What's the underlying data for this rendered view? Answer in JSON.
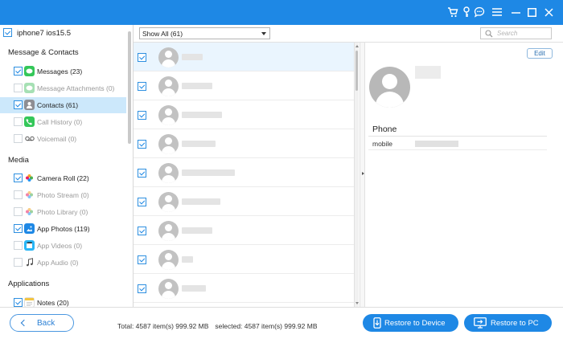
{
  "device": {
    "label": "iphone7 ios15.5",
    "checked": true
  },
  "sidebar": {
    "sections": [
      {
        "title": "Message & Contacts"
      },
      {
        "title": "Media"
      },
      {
        "title": "Applications"
      }
    ],
    "items": [
      {
        "label": "Messages (23)",
        "checked": true,
        "enabled": true,
        "icon": "messages-icon",
        "color": "#34c759"
      },
      {
        "label": "Message Attachments (0)",
        "checked": false,
        "enabled": false,
        "icon": "attachments-icon",
        "color": "#34c759"
      },
      {
        "label": "Contacts (61)",
        "checked": true,
        "enabled": true,
        "selected": true,
        "icon": "contacts-icon",
        "color": "#8e8e93"
      },
      {
        "label": "Call History (0)",
        "checked": false,
        "enabled": false,
        "icon": "phone-icon",
        "color": "#34c759"
      },
      {
        "label": "Voicemail (0)",
        "checked": false,
        "enabled": false,
        "icon": "voicemail-icon",
        "color": "#555555"
      },
      {
        "label": "Camera Roll (22)",
        "checked": true,
        "enabled": true,
        "icon": "camera-roll-icon",
        "color": "#f5a623"
      },
      {
        "label": "Photo Stream (0)",
        "checked": false,
        "enabled": false,
        "icon": "photo-stream-icon",
        "color": "#f5a623"
      },
      {
        "label": "Photo Library (0)",
        "checked": false,
        "enabled": false,
        "icon": "photo-library-icon",
        "color": "#f5a623"
      },
      {
        "label": "App Photos (119)",
        "checked": true,
        "enabled": true,
        "icon": "app-photos-icon",
        "color": "#1e88e5"
      },
      {
        "label": "App Videos (0)",
        "checked": false,
        "enabled": false,
        "icon": "app-videos-icon",
        "color": "#29b6f6"
      },
      {
        "label": "App Audio (0)",
        "checked": false,
        "enabled": false,
        "icon": "app-audio-icon",
        "color": "#555555"
      },
      {
        "label": "Notes (20)",
        "checked": true,
        "enabled": true,
        "icon": "notes-icon",
        "color": "#f4c542"
      }
    ]
  },
  "filter": {
    "selected": "Show All (61)"
  },
  "search": {
    "placeholder": "Search"
  },
  "contacts": {
    "rows_checked": [
      true,
      true,
      true,
      true,
      true,
      true,
      true,
      true,
      true
    ]
  },
  "detail": {
    "edit_label": "Edit",
    "phone_title": "Phone",
    "phone_type": "mobile"
  },
  "footer": {
    "back_label": "Back",
    "total": "Total: 4587 item(s) 999.92 MB",
    "selected": "selected: 4587 item(s) 999.92 MB",
    "restore_device_label": "Restore to Device",
    "restore_pc_label": "Restore to PC"
  },
  "colors": {
    "accent": "#1e88e5",
    "selected_row": "#cce8fb",
    "highlight_row": "#eaf5fe"
  },
  "titlebar_icons": [
    "cart-icon",
    "key-icon",
    "feedback-icon",
    "menu-icon",
    "minimize-icon",
    "maximize-icon",
    "close-icon"
  ]
}
